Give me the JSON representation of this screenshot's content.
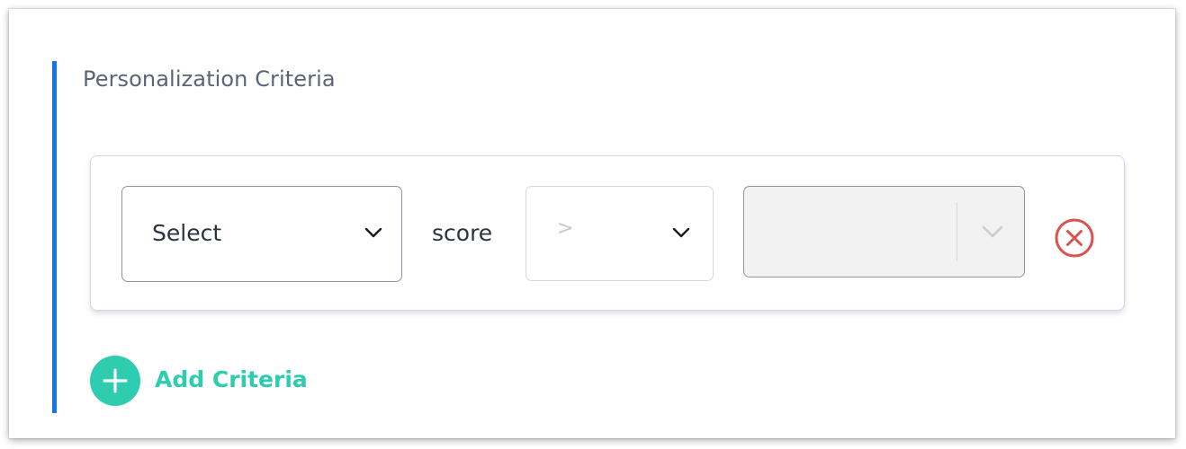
{
  "section": {
    "title": "Personalization Criteria",
    "accent_color": "#1a73e8"
  },
  "criteria_row": {
    "field_select": {
      "value": "Select",
      "icon": "chevron-down-icon"
    },
    "score_label": "score",
    "operator_select": {
      "value": ">",
      "icon": "chevron-down-icon"
    },
    "value_select": {
      "value": "",
      "disabled": true,
      "icon": "chevron-down-icon"
    },
    "remove_icon": "close-circle-icon",
    "remove_color": "#d9534f"
  },
  "add_criteria": {
    "label": "Add Criteria",
    "icon": "plus-icon",
    "color": "#2ecdaf"
  }
}
